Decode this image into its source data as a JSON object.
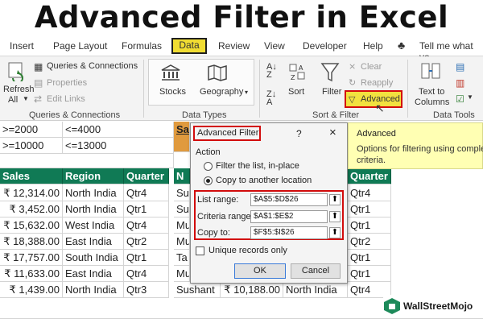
{
  "title": "Advanced Filter in Excel",
  "tabs": [
    "Insert",
    "Page Layout",
    "Formulas",
    "Data",
    "Review",
    "View",
    "Developer",
    "Help",
    "Tell me what yo"
  ],
  "ribbon": {
    "refresh": "Refresh",
    "all": "All",
    "queries_connections": "Queries & Connections",
    "properties": "Properties",
    "edit_links": "Edit Links",
    "group_queries": "Queries & Connections",
    "stocks": "Stocks",
    "geography": "Geography",
    "group_types": "Data Types",
    "sort": "Sort",
    "filter": "Filter",
    "clear": "Clear",
    "reapply": "Reapply",
    "advanced": "Advanced",
    "group_sort": "Sort & Filter",
    "text_to": "Text to",
    "columns": "Columns",
    "group_tools": "Data Tools"
  },
  "criteria": [
    [
      ">=2000",
      "<=4000"
    ],
    [
      ">=10000",
      "<=13000"
    ]
  ],
  "partial_header": "Sa",
  "table": {
    "headers": [
      "Sales",
      "Region",
      "Quarter"
    ],
    "rows": [
      [
        "₹ 12,314.00",
        "North India",
        "Qtr4"
      ],
      [
        "₹ 3,452.00",
        "North India",
        "Qtr1"
      ],
      [
        "₹ 15,632.00",
        "West India",
        "Qtr4"
      ],
      [
        "₹ 18,388.00",
        "East India",
        "Qtr2"
      ],
      [
        "₹ 17,757.00",
        "South India",
        "Qtr1"
      ],
      [
        "₹ 11,633.00",
        "East India",
        "Qtr4"
      ],
      [
        "₹ 1,439.00",
        "North India",
        "Qtr3"
      ]
    ]
  },
  "right_table": {
    "header_n": "N",
    "header_quarter": "Quarter",
    "names": [
      "Su",
      "Su",
      "Mu",
      "Mu",
      "Ta",
      "Mu",
      "Sushant"
    ],
    "last_row_sales": "₹ 10,188.00",
    "last_row_region": "North India",
    "quarters": [
      "Qtr4",
      "Qtr1",
      "Qtr1",
      "Qtr2",
      "Qtr1",
      "Qtr1",
      "Qtr4"
    ]
  },
  "dialog": {
    "title": "Advanced Filter",
    "help": "?",
    "close": "×",
    "action": "Action",
    "opt1": "Filter the list, in-place",
    "opt2": "Copy to another location",
    "list_range_label": "List range:",
    "list_range_value": "$A$5:$D$26",
    "criteria_label": "Criteria range:",
    "criteria_value": "$A$1:$E$2",
    "copy_label": "Copy to:",
    "copy_value": "$F$5:$I$26",
    "unique": "Unique records only",
    "ok": "OK",
    "cancel": "Cancel"
  },
  "tooltip": {
    "title": "Advanced",
    "body1": "Options for filtering using complex",
    "body2": "criteria."
  },
  "brand": "WallStreetMojo",
  "colors": {
    "header_green": "#107a55",
    "highlight_yellow": "#f0dc32",
    "red_box": "#d20c0c"
  }
}
